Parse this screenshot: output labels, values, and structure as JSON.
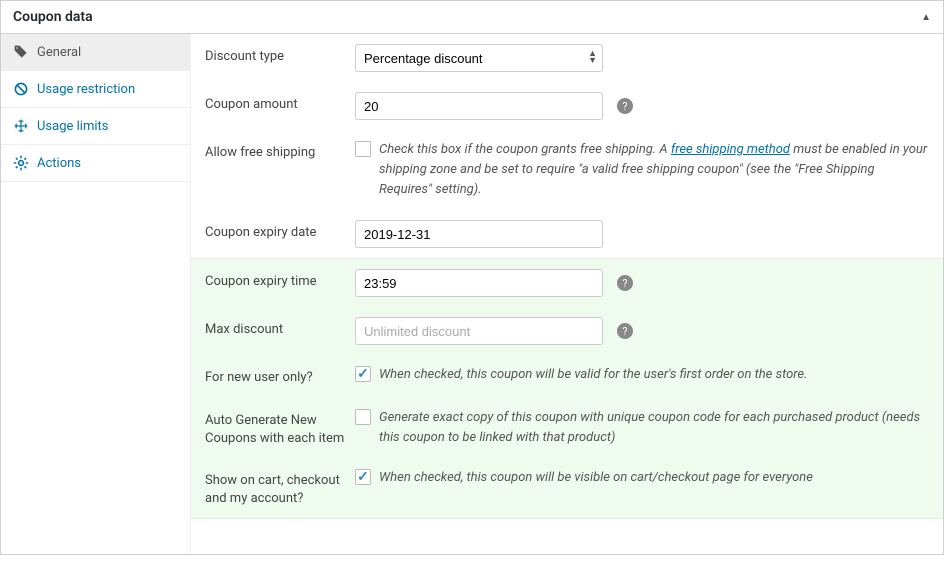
{
  "header": {
    "title": "Coupon data"
  },
  "tabs": [
    {
      "label": "General"
    },
    {
      "label": "Usage restriction"
    },
    {
      "label": "Usage limits"
    },
    {
      "label": "Actions"
    }
  ],
  "fields": {
    "discount_type": {
      "label": "Discount type",
      "value": "Percentage discount"
    },
    "coupon_amount": {
      "label": "Coupon amount",
      "value": "20"
    },
    "free_shipping": {
      "label": "Allow free shipping",
      "checked": false,
      "desc_before": "Check this box if the coupon grants free shipping. A ",
      "desc_link": "free shipping method",
      "desc_after": " must be enabled in your shipping zone and be set to require \"a valid free shipping coupon\" (see the \"Free Shipping Requires\" setting)."
    },
    "expiry_date": {
      "label": "Coupon expiry date",
      "value": "2019-12-31"
    },
    "expiry_time": {
      "label": "Coupon expiry time",
      "value": "23:59"
    },
    "max_discount": {
      "label": "Max discount",
      "placeholder": "Unlimited discount",
      "value": ""
    },
    "new_user": {
      "label": "For new user only?",
      "checked": true,
      "desc": "When checked, this coupon will be valid for the user's first order on the store."
    },
    "auto_generate": {
      "label": "Auto Generate New Coupons with each item",
      "checked": false,
      "desc": "Generate exact copy of this coupon with unique coupon code for each purchased product (needs this coupon to be linked with that product)"
    },
    "show_on_cart": {
      "label": "Show on cart, checkout and my account?",
      "checked": true,
      "desc": "When checked, this coupon will be visible on cart/checkout page for everyone"
    }
  }
}
